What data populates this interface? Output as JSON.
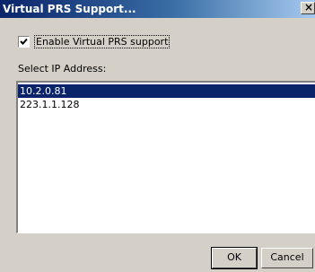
{
  "window": {
    "title": "Virtual PRS Support...",
    "close_glyph": "×",
    "title_gradient": [
      "#0a246a",
      "#a6caf0"
    ]
  },
  "enable_checkbox": {
    "label": "Enable Virtual PRS support",
    "checked": true
  },
  "ip_select": {
    "label": "Select IP Address:",
    "items": [
      "10.2.0.81",
      "223.1.1.128"
    ],
    "selected_index": 0,
    "selection_color": "#0a246a"
  },
  "buttons": {
    "ok": "OK",
    "cancel": "Cancel"
  }
}
